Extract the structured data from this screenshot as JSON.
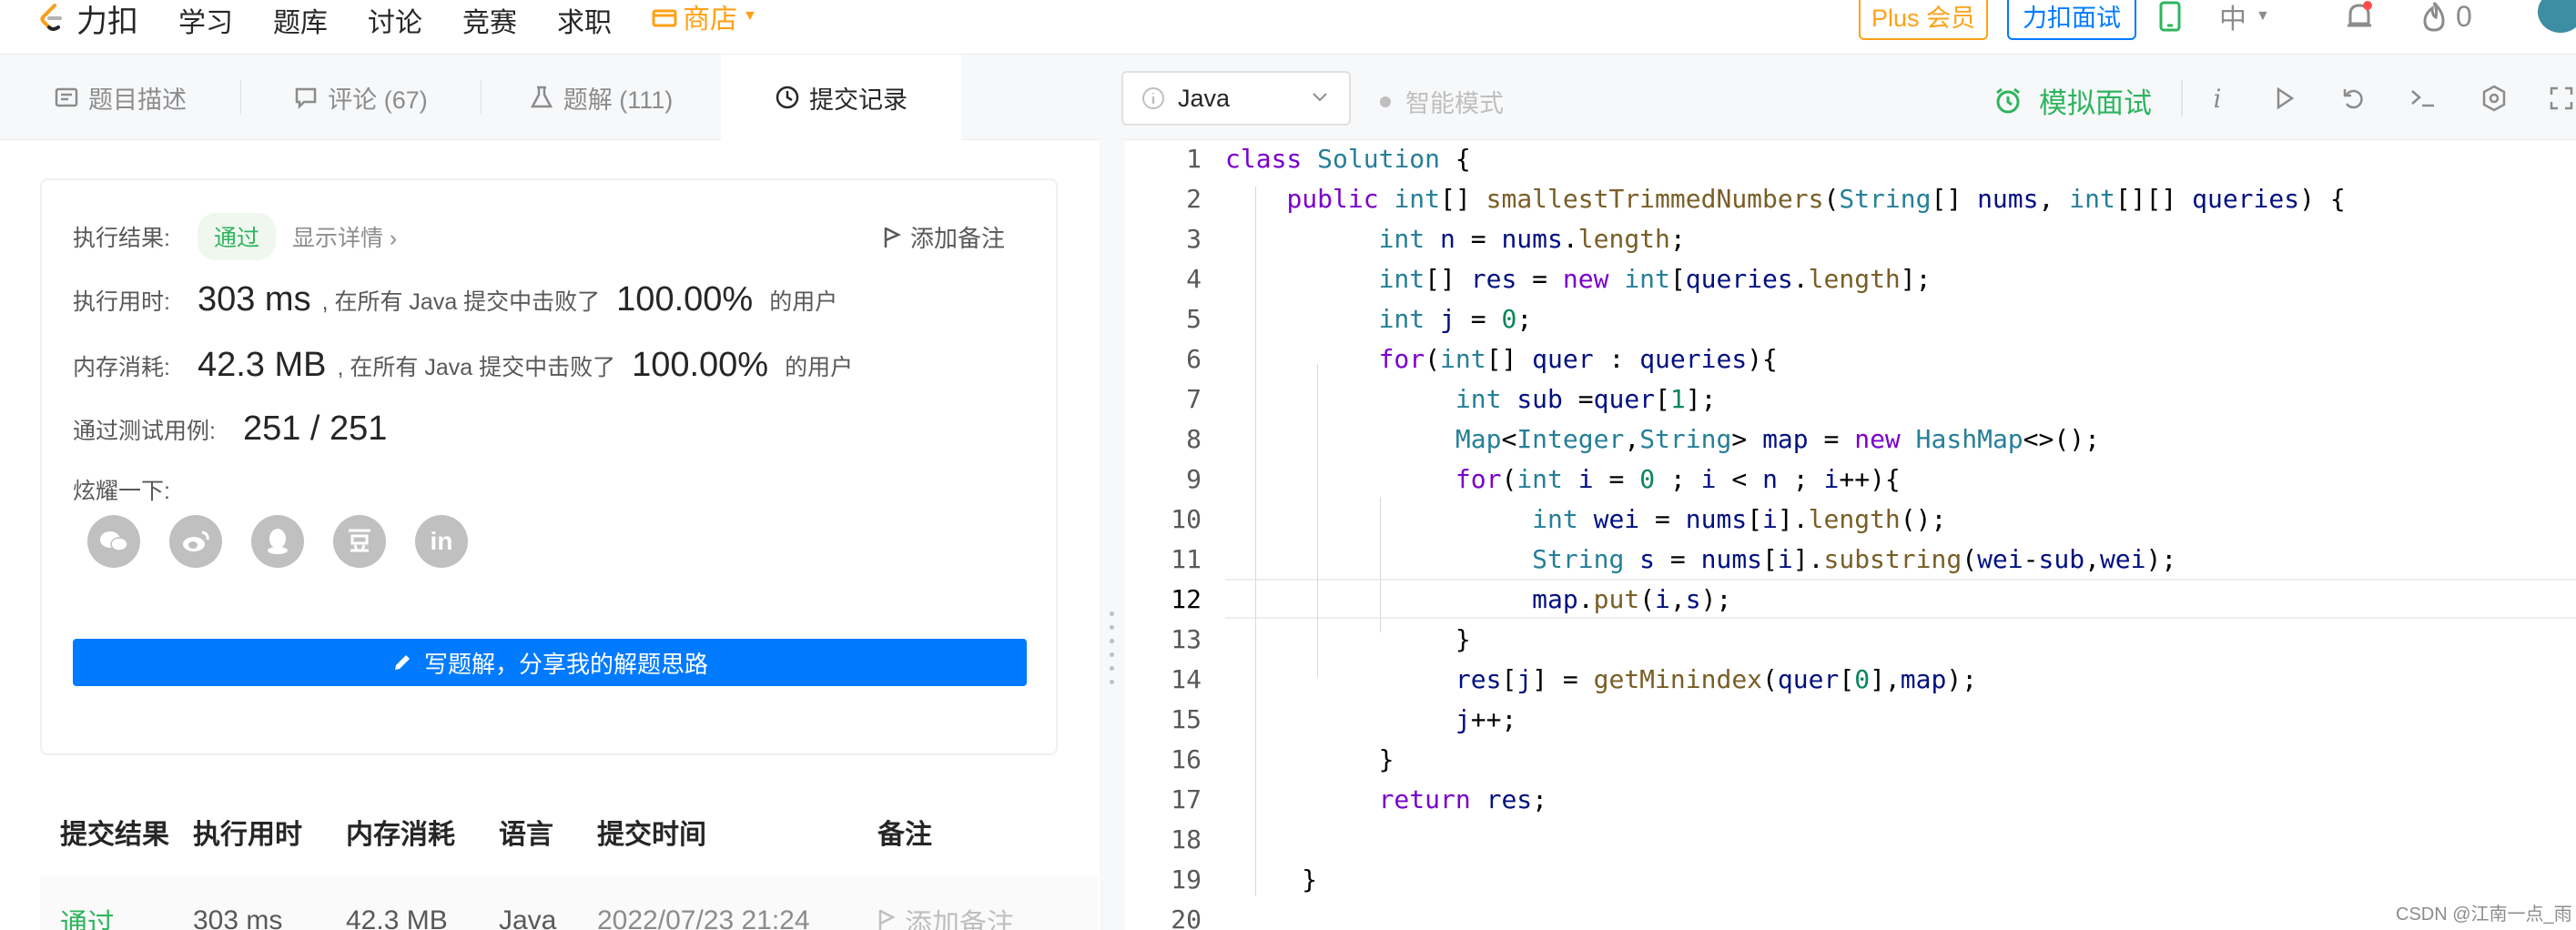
{
  "topnav": {
    "brand": "力扣",
    "links": [
      "学习",
      "题库",
      "讨论",
      "竞赛",
      "求职"
    ],
    "store": "商店",
    "plus": "Plus 会员",
    "interview": "力扣面试",
    "lang": "中",
    "streak": "0",
    "icons": [
      "logo-icon",
      "store-icon",
      "phone-icon",
      "chevron-down-icon",
      "bell-icon",
      "flame-icon"
    ],
    "colors": {
      "accent_orange": "#ffa116",
      "accent_blue": "#007aff",
      "green": "#2db55d"
    }
  },
  "tabs": [
    {
      "label": "题目描述",
      "icon": "document-icon"
    },
    {
      "label": "评论 (67)",
      "icon": "comment-icon"
    },
    {
      "label": "题解 (111)",
      "icon": "flask-icon"
    },
    {
      "label": "提交记录",
      "icon": "clock-icon",
      "active": true
    }
  ],
  "result": {
    "status_label": "执行结果:",
    "status": "通过",
    "detail": "显示详情 ›",
    "add_note": "添加备注",
    "runtime_label": "执行用时:",
    "runtime": "303 ms",
    "runtime_mid": ", 在所有 Java 提交中击败了",
    "runtime_pct": "100.00%",
    "runtime_tail": "的用户",
    "memory_label": "内存消耗:",
    "memory": "42.3 MB",
    "memory_mid": ", 在所有 Java 提交中击败了",
    "memory_pct": "100.00%",
    "memory_tail": "的用户",
    "tests_label": "通过测试用例:",
    "tests": "251 / 251",
    "share_label": "炫耀一下:",
    "share_icons": [
      "wechat-icon",
      "weibo-icon",
      "qq-icon",
      "douban-icon",
      "linkedin-icon"
    ],
    "write_button": "写题解，分享我的解题思路"
  },
  "submissions": {
    "headers": [
      "提交结果",
      "执行用时",
      "内存消耗",
      "语言",
      "提交时间",
      "备注"
    ],
    "rows": [
      [
        "通过",
        "303 ms",
        "42.3 MB",
        "Java",
        "2022/07/23 21:24",
        "添加备注"
      ]
    ]
  },
  "editor_toolbar": {
    "language": "Java",
    "smart_mode": "智能模式",
    "mock_interview": "模拟面试",
    "tool_icons": [
      "info-icon",
      "run-icon",
      "reset-icon",
      "terminal-icon",
      "settings-icon",
      "fullscreen-icon"
    ]
  },
  "code": {
    "current_line": 12,
    "lines": [
      "class Solution {",
      "    public int[] smallestTrimmedNumbers(String[] nums, int[][] queries) {",
      "          int n = nums.length;",
      "          int[] res = new int[queries.length];",
      "          int j = 0;",
      "          for(int[] quer : queries){",
      "               int sub =quer[1];",
      "               Map<Integer,String> map = new HashMap<>();",
      "               for(int i = 0 ; i < n ; i++){",
      "                    int wei = nums[i].length();",
      "                    String s = nums[i].substring(wei-sub,wei);",
      "                    map.put(i,s);",
      "               }",
      "               res[j] = getMinindex(quer[0],map);",
      "               j++;",
      "          }",
      "          return res;",
      "",
      "     }",
      ""
    ]
  },
  "watermark": "CSDN @江南一点_雨"
}
